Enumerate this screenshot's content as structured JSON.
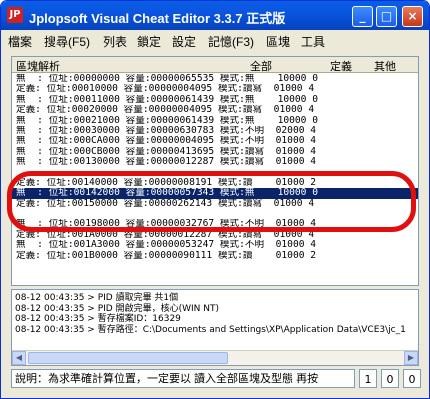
{
  "window": {
    "title": "Jplopsoft Visual Cheat Editor 3.3.7 正式版",
    "app_icon": "JP"
  },
  "titlebar_buttons": {
    "minimize": "_",
    "maximize": "□",
    "close": "×"
  },
  "menu": [
    "檔案",
    "搜尋(F5)",
    "列表",
    "鎖定",
    "設定",
    "記憶(F3)",
    "區塊",
    "工具"
  ],
  "panel": {
    "title": "區塊解析",
    "col_all": "全部",
    "col_def": "定義",
    "col_other": "其他"
  },
  "rows": [
    "無  : 位址:00000000 容量:00000065535 模式:無    10000 0",
    "定義: 位址:00010000 容量:00000004095 模式:讀寫  01000 4",
    "無  : 位址:00011000 容量:00000061439 模式:無    10000 0",
    "定義: 位址:00020000 容量:00000004095 模式:讀寫  01000 4",
    "無  : 位址:00021000 容量:00000061439 模式:無    10000 0",
    "無  : 位址:00030000 容量:00000630783 模式:不明  02000 4",
    "無  : 位址:000CA000 容量:00000004095 模式:不明  01000 4",
    "無  : 位址:000CB000 容量:00000413695 模式:讀寫  01000 4",
    "無  : 位址:00130000 容量:00000012287 模式:讀寫  01000 4",
    "",
    "定義: 位址:00140000 容量:00000008191 模式:讀    01000 2",
    "無  : 位址:00142000 容量:00000057343 模式:無    10000 0",
    "定義: 位址:00150000 容量:00000262143 模式:讀寫  01000 4",
    "",
    "無  : 位址:00198000 容量:00000032767 模式:不明  01000 4",
    "定義: 位址:001A0000 容量:00000012287 模式:讀寫  01000 4",
    "無  : 位址:001A3000 容量:00000053247 模式:不明  01000 4",
    "定義: 位址:001B0000 容量:00000090111 模式:讀    01000 2"
  ],
  "log": [
    "08-12 00:43:35 > PID 讀取完畢 共1個",
    "08-12 00:43:35 > PID 開啟完畢，核心(WIN NT)",
    "08-12 00:43:35 > 暫存檔案ID：16329",
    "08-12 00:43:35 > 暫存路徑：C:\\Documents and Settings\\XP\\Application Data\\VCE3\\jc_1"
  ],
  "status": {
    "text": "說明：為求準確計算位置，一定要以 讀入全部區塊及型態 再按",
    "box1": "1",
    "box2": "0",
    "box3": "0"
  }
}
